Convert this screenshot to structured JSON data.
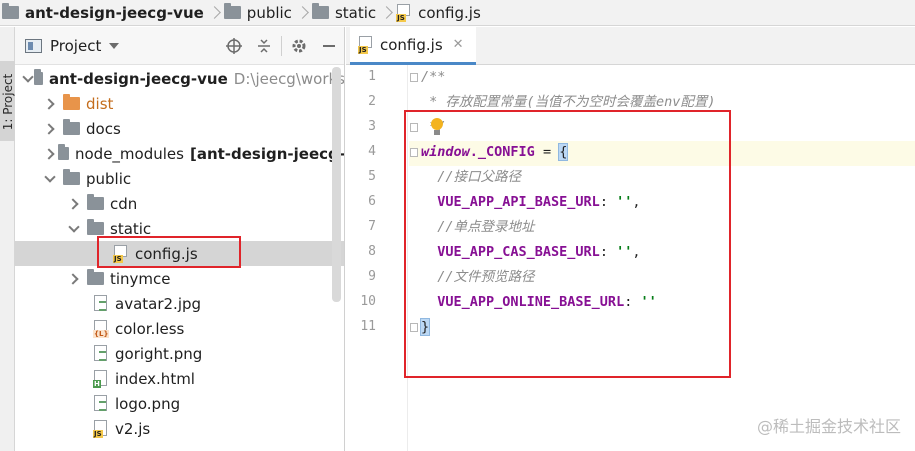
{
  "breadcrumb": {
    "items": [
      "ant-design-jeecg-vue",
      "public",
      "static",
      "config.js"
    ]
  },
  "sidebar": {
    "tab_label": "1: Project"
  },
  "project_panel": {
    "title": "Project",
    "tools": [
      "target-icon",
      "collapse-icon",
      "gear-icon",
      "minimize-icon"
    ],
    "tree": [
      {
        "label": "ant-design-jeecg-vue",
        "path": "D:\\jeecg\\works",
        "expanded": true
      },
      {
        "label": "dist",
        "expanded": false
      },
      {
        "label": "docs",
        "expanded": false
      },
      {
        "label": "node_modules",
        "extra": "[ant-design-jeecg-",
        "expanded": false
      },
      {
        "label": "public",
        "expanded": true
      },
      {
        "label": "cdn",
        "expanded": false
      },
      {
        "label": "static",
        "expanded": true
      },
      {
        "label": "config.js",
        "selected": true
      },
      {
        "label": "tinymce",
        "expanded": false
      },
      {
        "label": "avatar2.jpg"
      },
      {
        "label": "color.less"
      },
      {
        "label": "goright.png"
      },
      {
        "label": "index.html"
      },
      {
        "label": "logo.png"
      },
      {
        "label": "v2.js"
      }
    ]
  },
  "editor": {
    "tab_label": "config.js",
    "line_numbers": [
      "1",
      "2",
      "3",
      "4",
      "5",
      "6",
      "7",
      "8",
      "9",
      "10",
      "11"
    ],
    "lines": {
      "l1": "/**",
      "l2": " * 存放配置常量(当值不为空时会覆盖env配置)",
      "l3": " */",
      "l4_kw": "window",
      "l4_prop": "._CONFIG",
      "l4_eq": " = ",
      "l4_brace": "{",
      "l5": "  //接口父路径",
      "l6_key": "  VUE_APP_API_BASE_URL",
      "l6_colon": ": ",
      "l6_val": "''",
      "l6_end": ",",
      "l7": "  //单点登录地址",
      "l8_key": "  VUE_APP_CAS_BASE_URL",
      "l8_colon": ": ",
      "l8_val": "''",
      "l8_end": ",",
      "l9": "  //文件预览路径",
      "l10_key": "  VUE_APP_ONLINE_BASE_URL",
      "l10_colon": ": ",
      "l10_val": "''",
      "l11": "}"
    }
  },
  "watermark": "@稀土掘金技术社区",
  "colors": {
    "annotation_red": "#e0242a",
    "keyword_purple": "#871094",
    "string_green": "#067d17",
    "comment_gray": "#8c8c8c"
  }
}
